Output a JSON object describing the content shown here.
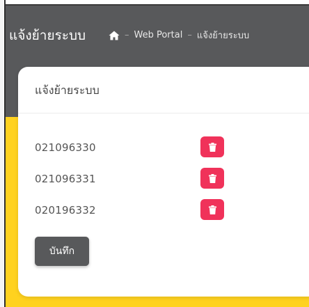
{
  "header": {
    "title": "แจ้งย้ายระบบ",
    "breadcrumb": {
      "home_icon": "home-icon",
      "separator": "–",
      "items": [
        "Web Portal",
        "แจ้งย้ายระบบ"
      ]
    }
  },
  "card": {
    "title": "แจ้งย้ายระบบ",
    "rows": [
      {
        "number": "021096330",
        "delete_icon": "trash-icon"
      },
      {
        "number": "021096331",
        "delete_icon": "trash-icon"
      },
      {
        "number": "020196332",
        "delete_icon": "trash-icon"
      }
    ],
    "save_label": "บันทึก"
  },
  "colors": {
    "header_bg": "#58595b",
    "accent_yellow": "#ffd21f",
    "delete_red": "#f0325a",
    "save_button": "#58595b"
  }
}
